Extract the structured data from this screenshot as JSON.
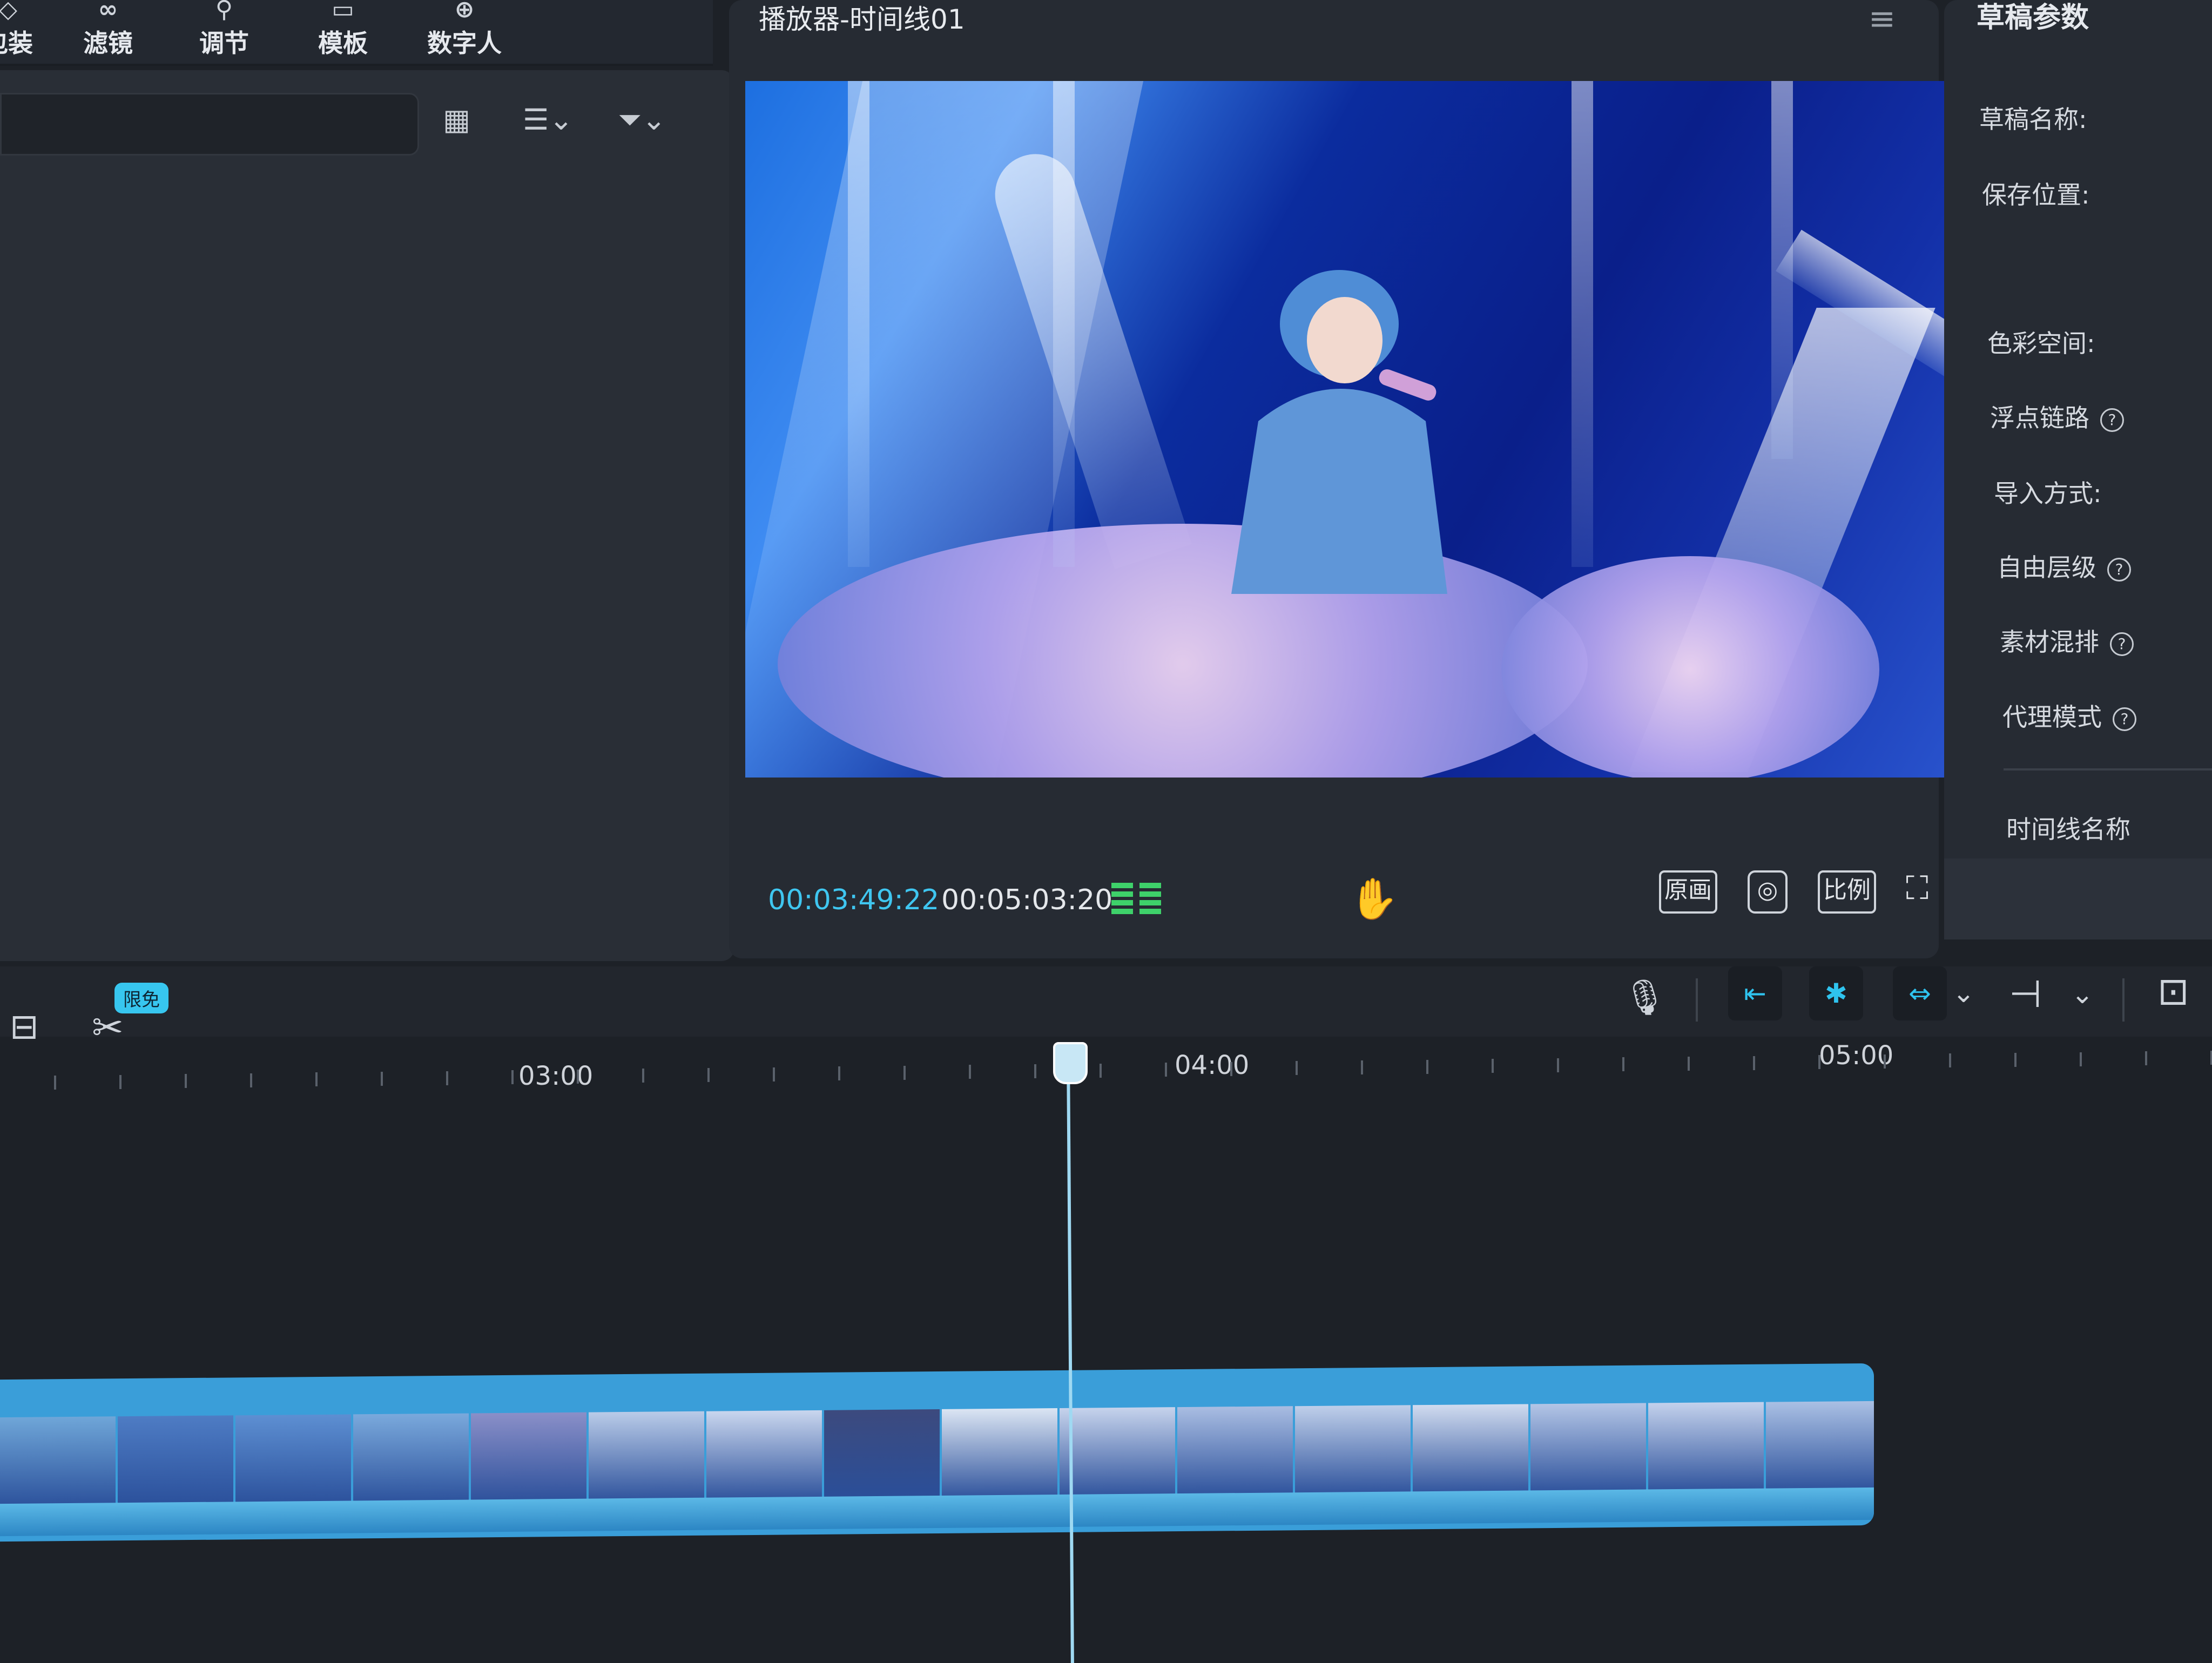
{
  "toolbar": {
    "items": [
      {
        "label": "包装",
        "icon": "decor-icon"
      },
      {
        "label": "滤镜",
        "icon": "filter-icon"
      },
      {
        "label": "调节",
        "icon": "adjust-icon"
      },
      {
        "label": "模板",
        "icon": "template-icon"
      },
      {
        "label": "数字人",
        "icon": "digital-human-icon"
      }
    ]
  },
  "player": {
    "title": "播放器-时间线01",
    "current_time": "00:03:49:22",
    "total_time": "00:05:03:20",
    "buttons": {
      "original": "原画",
      "ratio": "比例"
    }
  },
  "params": {
    "title": "草稿参数",
    "labels": {
      "name": "草稿名称:",
      "location": "保存位置:",
      "color_space": "色彩空间:",
      "float_link": "浮点链路",
      "import_mode": "导入方式:",
      "free_layer": "自由层级",
      "material_mix": "素材混排",
      "proxy_mode": "代理模式",
      "timeline_name": "时间线名称"
    }
  },
  "timeline": {
    "badge": "限免",
    "ruler": [
      "03:00",
      "04:00",
      "05:00"
    ]
  },
  "colors": {
    "accent": "#37c6ef",
    "clip": "#3a9ed9",
    "meter": "#3ed16a"
  }
}
